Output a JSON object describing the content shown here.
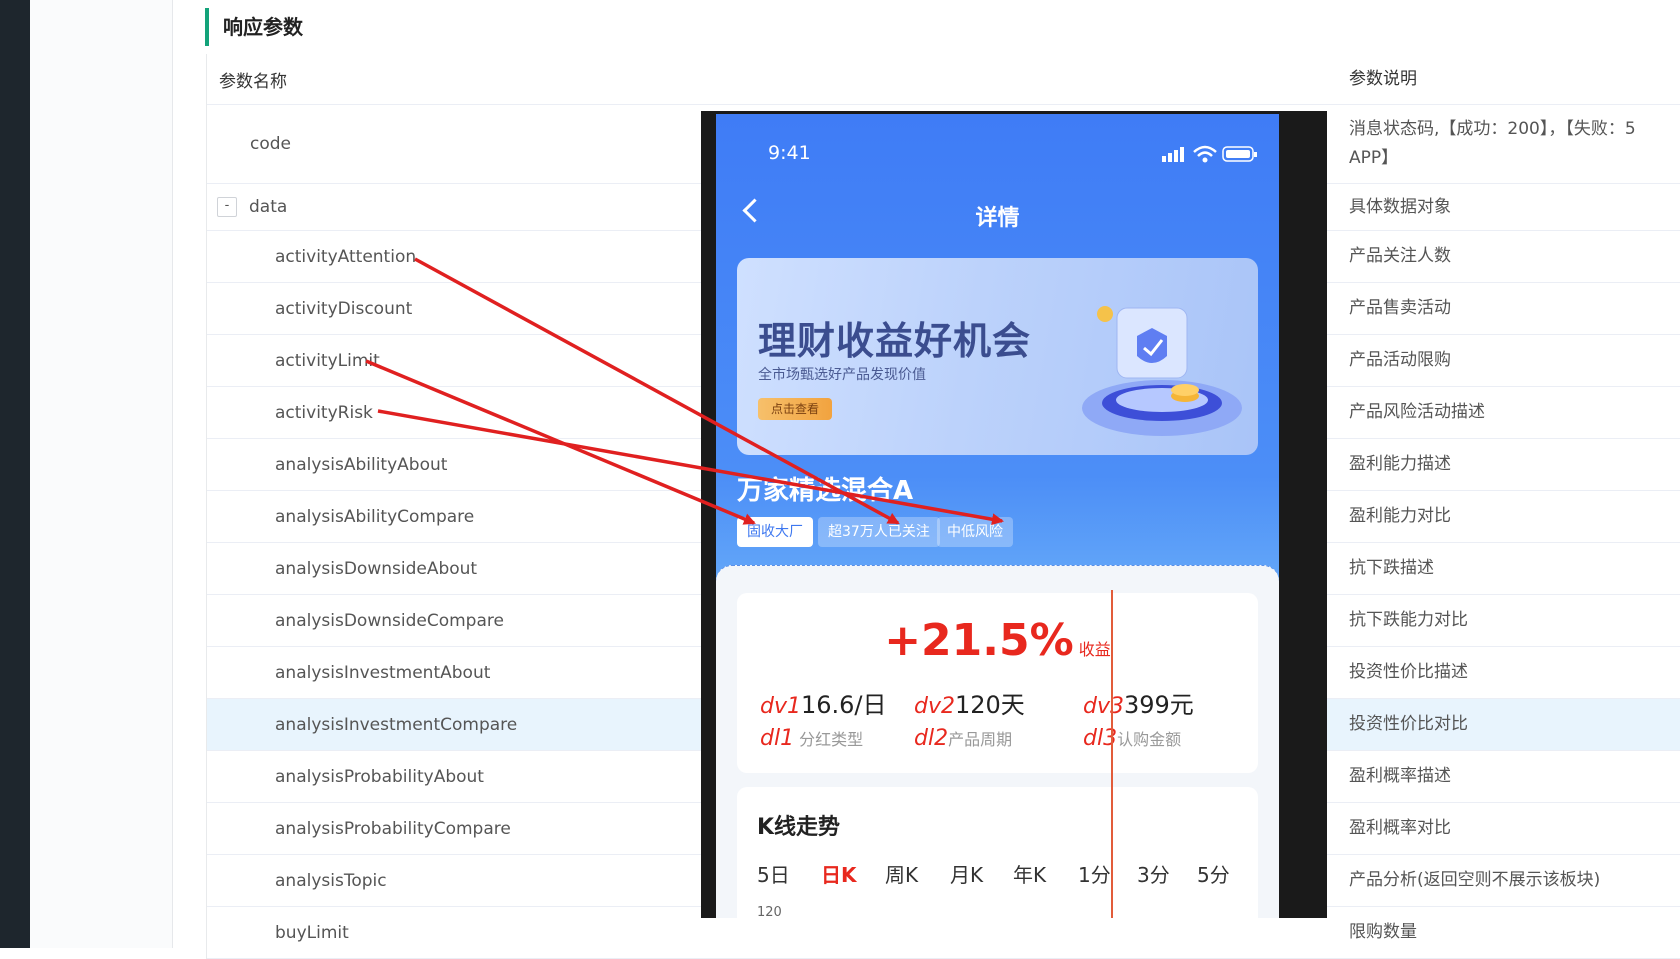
{
  "section": {
    "title": "响应参数"
  },
  "table": {
    "header": {
      "name": "参数名称",
      "desc": "参数说明"
    },
    "rows": [
      {
        "name": "code",
        "desc": "消息状态码,【成功：200】，【失败：5",
        "desc2": "APP】"
      },
      {
        "name": "data",
        "desc": "具体数据对象",
        "toggle": "-"
      },
      {
        "name": "activityAttention",
        "desc": "产品关注人数"
      },
      {
        "name": "activityDiscount",
        "desc": "产品售卖活动"
      },
      {
        "name": "activityLimit",
        "desc": "产品活动限购"
      },
      {
        "name": "activityRisk",
        "desc": "产品风险活动描述"
      },
      {
        "name": "analysisAbilityAbout",
        "desc": "盈利能力描述"
      },
      {
        "name": "analysisAbilityCompare",
        "desc": "盈利能力对比"
      },
      {
        "name": "analysisDownsideAbout",
        "desc": "抗下跌描述"
      },
      {
        "name": "analysisDownsideCompare",
        "desc": "抗下跌能力对比"
      },
      {
        "name": "analysisInvestmentAbout",
        "desc": "投资性价比描述"
      },
      {
        "name": "analysisInvestmentCompare",
        "desc": "投资性价比对比"
      },
      {
        "name": "analysisProbabilityAbout",
        "desc": "盈利概率描述"
      },
      {
        "name": "analysisProbabilityCompare",
        "desc": "盈利概率对比"
      },
      {
        "name": "analysisTopic",
        "desc": "产品分析(返回空则不展示该板块)"
      },
      {
        "name": "buyLimit",
        "desc": "限购数量"
      }
    ]
  },
  "phone": {
    "time": "9:41",
    "nav_title": "详情",
    "banner": {
      "headline": "理财收益好机会",
      "sub": "全市场甄选好产品发现价值",
      "button": "点击查看"
    },
    "fund_name": "万家精选混合A",
    "tags": [
      "固收大厂",
      "超37万人已关注",
      "中低风险"
    ],
    "rate": {
      "value": "+21.5%",
      "label": "收益"
    },
    "stats": [
      {
        "mark_v": "dv1",
        "value": "16.6/日",
        "mark_l": "dl1",
        "label": "分红类型"
      },
      {
        "mark_v": "dv2",
        "value": "120天",
        "mark_l": "dl2",
        "label": "产品周期"
      },
      {
        "mark_v": "dv3",
        "value": "399元",
        "mark_l": "dl3",
        "label": "认购金额"
      }
    ],
    "kline": {
      "title": "K线走势",
      "tabs": [
        "5日",
        "日K",
        "周K",
        "月K",
        "年K",
        "1分",
        "3分",
        "5分"
      ],
      "active": "日K",
      "y_tick": "120"
    }
  },
  "colors": {
    "accent": "#13a37a",
    "highlight_row": "#e8f4fd",
    "annotation": "#e02020",
    "phone_blue": "#3f7cf6"
  }
}
